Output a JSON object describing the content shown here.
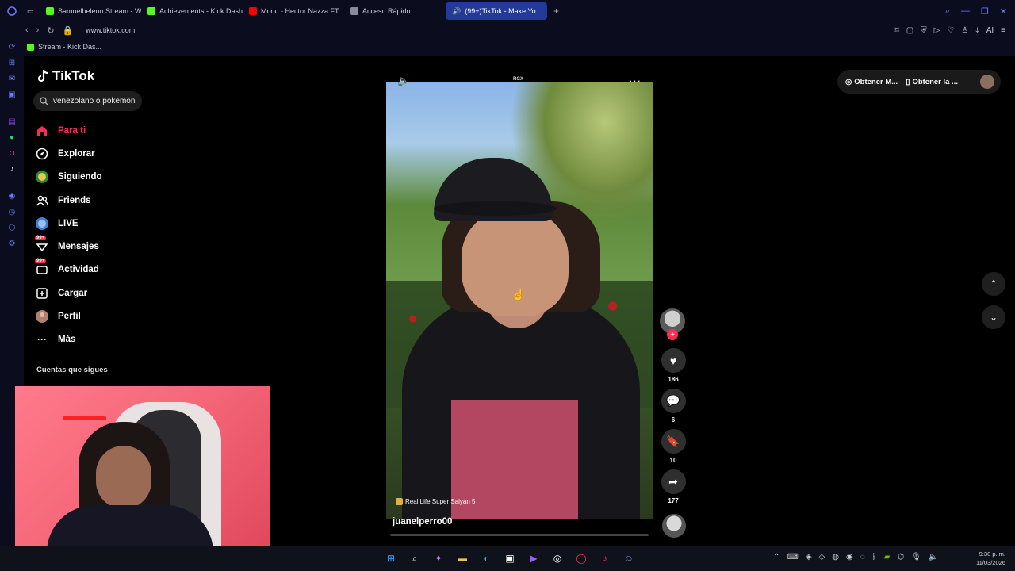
{
  "browser": {
    "tabs": [
      {
        "label": "Samuelbeleno Stream - W",
        "favicon_color": "#53fc18",
        "active": false
      },
      {
        "label": "Achievements - Kick Dash",
        "favicon_color": "#53fc18",
        "active": false
      },
      {
        "label": "Mood - Hector Nazza FT.",
        "favicon_color": "#ff0000",
        "active": false
      },
      {
        "label": "Acceso Rápido",
        "favicon_color": "#c9c9d9",
        "active": false
      },
      {
        "label": "(99+)TikTok - Make Yo",
        "favicon_color": "#000000",
        "active": true
      }
    ],
    "url": "www.tiktok.com",
    "bookmark": "Stream - Kick Das...",
    "ai_label": "AI"
  },
  "tiktok": {
    "logo_text": "TikTok",
    "search_value": "venezolano o pokemon",
    "nav": [
      {
        "label": "Para ti",
        "icon": "home-icon",
        "active": true
      },
      {
        "label": "Explorar",
        "icon": "compass-icon",
        "active": false
      },
      {
        "label": "Siguiendo",
        "icon": "following-icon",
        "active": false
      },
      {
        "label": "Friends",
        "icon": "friends-icon",
        "active": false
      },
      {
        "label": "LIVE",
        "icon": "live-icon",
        "active": false
      },
      {
        "label": "Mensajes",
        "icon": "messages-icon",
        "active": false,
        "badge": "99+"
      },
      {
        "label": "Actividad",
        "icon": "activity-icon",
        "active": false,
        "badge": "99+"
      },
      {
        "label": "Cargar",
        "icon": "upload-icon",
        "active": false
      },
      {
        "label": "Perfil",
        "icon": "profile-icon",
        "active": false
      },
      {
        "label": "Más",
        "icon": "more-icon",
        "active": false
      }
    ],
    "following_title": "Cuentas que sigues",
    "video": {
      "watermark": "RGX",
      "music": "Real Life Super Saiyan 5",
      "author": "juanelperro00",
      "progress": 0.0
    },
    "actions": {
      "likes": "186",
      "comments": "6",
      "saves": "10",
      "shares": "177"
    },
    "top_buttons": [
      "Obtener M...",
      "Obtener la ..."
    ],
    "accent": "#fe2c55"
  },
  "taskbar": {
    "time": "9:30 p. m.",
    "date": "11/03/2026"
  }
}
